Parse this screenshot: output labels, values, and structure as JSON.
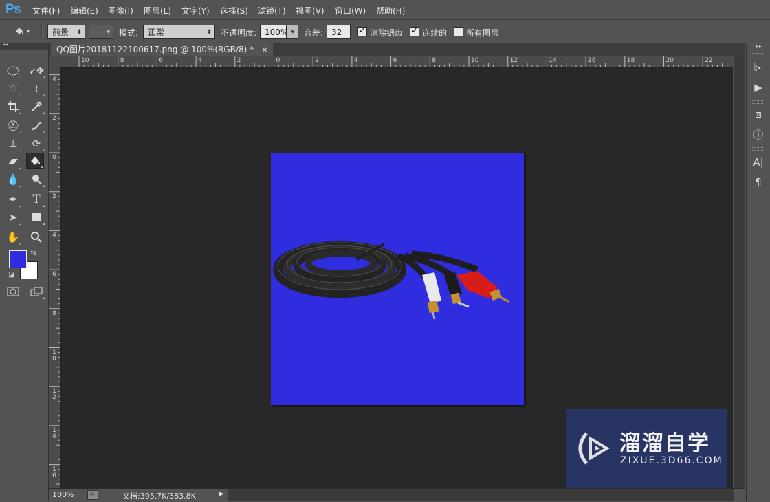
{
  "app": {
    "logo": "Ps"
  },
  "menu": [
    "文件(F)",
    "编辑(E)",
    "图像(I)",
    "图层(L)",
    "文字(Y)",
    "选择(S)",
    "滤镜(T)",
    "视图(V)",
    "窗口(W)",
    "帮助(H)"
  ],
  "options": {
    "fill_source": "前景",
    "pattern": "",
    "mode_label": "模式:",
    "mode_value": "正常",
    "opacity_label": "不透明度:",
    "opacity_value": "100%",
    "tolerance_label": "容差:",
    "tolerance_value": "32",
    "antialias_label": "消除锯齿",
    "antialias_checked": true,
    "contiguous_label": "连续的",
    "contiguous_checked": true,
    "all_layers_label": "所有图层",
    "all_layers_checked": false
  },
  "document": {
    "tab_title": "QQ图片20181122100617.png @ 100%(RGB/8) *",
    "close_glyph": "✕",
    "canvas_color": "#2f2ddf"
  },
  "rulers": {
    "h_labels": [
      "10",
      "8",
      "6",
      "4",
      "2",
      "0",
      "2",
      "4",
      "6",
      "8",
      "10",
      "12",
      "14",
      "16",
      "18",
      "20",
      "22"
    ],
    "v_labels": [
      "4",
      "2",
      "0",
      "2",
      "4",
      "6",
      "8",
      "10",
      "12",
      "14",
      "16"
    ]
  },
  "colors": {
    "foreground": "#2f2ddf",
    "background": "#ffffff"
  },
  "toolbox": {
    "active_tool": "paint-bucket-tool"
  },
  "status": {
    "zoom": "100%",
    "doc_size": "文档:395.7K/383.8K"
  },
  "watermark": {
    "title": "溜溜自学",
    "url": "ZIXUE.3D66.COM"
  }
}
